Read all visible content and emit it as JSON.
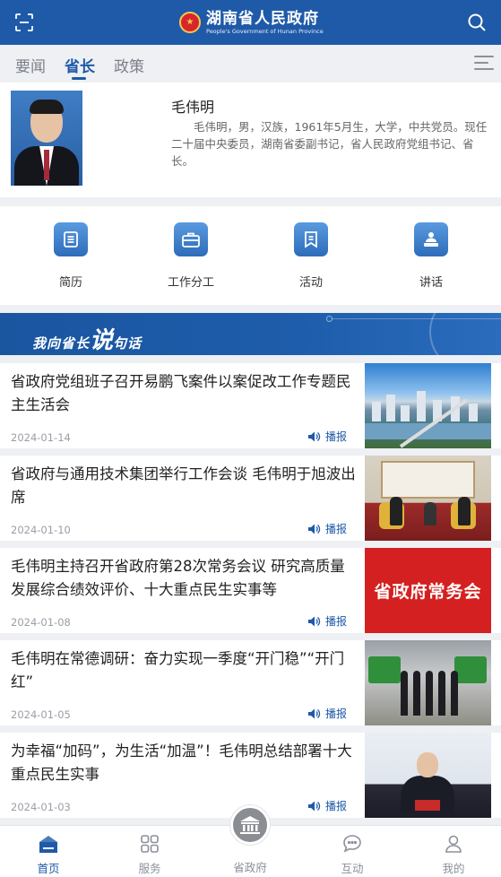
{
  "header": {
    "title_cn": "湖南省人民政府",
    "title_en": "People's Government of Hunan Province",
    "left_icon": "scan-icon",
    "right_icon": "search-icon"
  },
  "tabs": [
    {
      "label": "要闻",
      "active": false
    },
    {
      "label": "省长",
      "active": true
    },
    {
      "label": "政策",
      "active": false
    }
  ],
  "profile": {
    "name": "毛伟明",
    "bio": "毛伟明，男，汉族，1961年5月生，大学，中共党员。现任二十届中央委员，湖南省委副书记，省人民政府党组书记、省长。"
  },
  "actions": [
    {
      "label": "简历",
      "icon": "resume-icon"
    },
    {
      "label": "工作分工",
      "icon": "briefcase-icon"
    },
    {
      "label": "活动",
      "icon": "bookmark-icon"
    },
    {
      "label": "讲话",
      "icon": "speech-icon"
    }
  ],
  "banner": {
    "text_pre": "我向省长",
    "text_big": "说",
    "text_post": "句话"
  },
  "news": [
    {
      "title": "省政府党组班子召开易鹏飞案件以案促改工作专题民主生活会",
      "date": "2024-01-14",
      "play": "播报",
      "thumb": "city"
    },
    {
      "title": "省政府与通用技术集团举行工作会谈 毛伟明于旭波出席",
      "date": "2024-01-10",
      "play": "播报",
      "thumb": "meeting"
    },
    {
      "title": "毛伟明主持召开省政府第28次常务会议 研究高质量发展综合绩效评价、十大重点民生实事等",
      "date": "2024-01-08",
      "play": "播报",
      "thumb": "red",
      "thumb_text": "省政府常务会"
    },
    {
      "title": "毛伟明在常德调研：奋力实现一季度“开门稳”“开门红”",
      "date": "2024-01-05",
      "play": "播报",
      "thumb": "factory"
    },
    {
      "title": "为幸福“加码”，为生活“加温”！毛伟明总结部署十大重点民生实事",
      "date": "2024-01-03",
      "play": "播报",
      "thumb": "speech"
    }
  ],
  "bottom_nav": [
    {
      "label": "首页",
      "active": true
    },
    {
      "label": "服务",
      "active": false
    },
    {
      "label": "省政府",
      "active": false
    },
    {
      "label": "互动",
      "active": false
    },
    {
      "label": "我的",
      "active": false
    }
  ],
  "colors": {
    "primary": "#1f5aa8",
    "banner": "#1e5dab",
    "thumb_red": "#d42020"
  }
}
